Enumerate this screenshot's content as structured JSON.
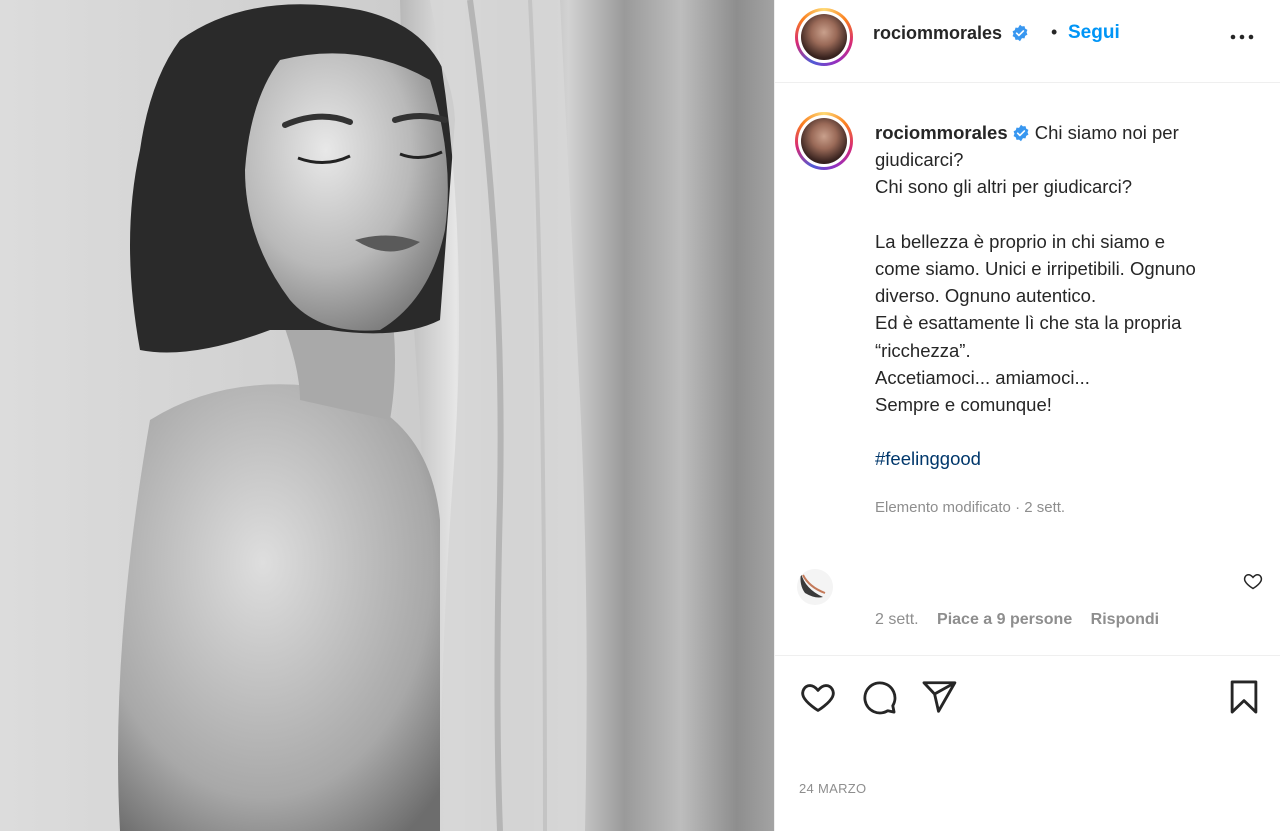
{
  "post": {
    "username": "rociommorales",
    "follow_label": "Segui",
    "separator": "•",
    "caption_lines": [
      "Chi siamo noi per",
      "giudicarci?",
      "Chi sono gli altri per giudicarci?",
      "",
      "La bellezza è proprio in chi siamo e",
      "come siamo. Unici e irripetibili. Ognuno",
      "diverso. Ognuno autentico.",
      "Ed è esattamente lì che sta la propria",
      "“ricchezza”.",
      "Accetiamoci... amiamoci...",
      "Sempre e comunque!",
      ""
    ],
    "hashtag": "#feelinggood",
    "edited_label": "Elemento modificato · 2 sett.",
    "date": "24 MARZO"
  },
  "comment": {
    "time": "2 sett.",
    "likes": "Piace a 9 persone",
    "reply": "Rispondi"
  },
  "icons": {
    "more": "more-options-icon",
    "verified": "verified-badge-icon",
    "like": "heart-icon",
    "comment": "comment-icon",
    "share": "share-icon",
    "save": "bookmark-icon"
  },
  "colors": {
    "link": "#0095f6",
    "hashtag": "#00376b",
    "muted": "#8e8e8e",
    "text": "#262626",
    "verified": "#3897f0"
  }
}
